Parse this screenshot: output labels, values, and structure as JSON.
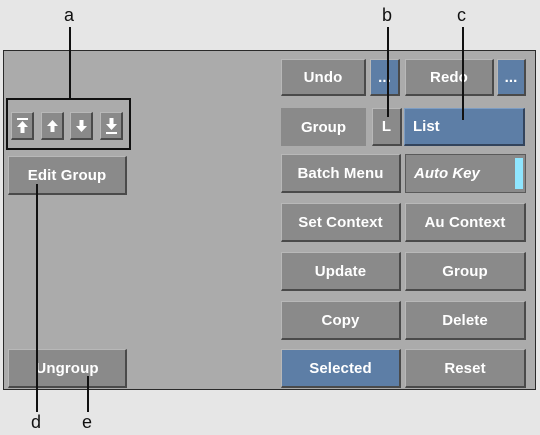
{
  "callouts": [
    "a",
    "b",
    "c",
    "d",
    "e"
  ],
  "buttons": {
    "undo": "Undo",
    "undo_more": "...",
    "redo": "Redo",
    "redo_more": "...",
    "group_label": "Group",
    "list_mode": "L",
    "list_value": "List",
    "batch_menu": "Batch Menu",
    "auto_key": "Auto Key",
    "set_context": "Set Context",
    "au_context": "Au Context",
    "update": "Update",
    "group": "Group",
    "copy": "Copy",
    "delete": "Delete",
    "selected": "Selected",
    "reset": "Reset",
    "edit_group": "Edit Group",
    "ungroup": "Ungroup"
  },
  "arrows": [
    "move-to-top-icon",
    "move-up-icon",
    "move-down-icon",
    "move-to-bottom-icon"
  ],
  "colors": {
    "panel": "#ababab",
    "button": "#8a8a8a",
    "accent_blue": "#5d7ea6",
    "auto_key_indicator": "#8fe6ff"
  }
}
